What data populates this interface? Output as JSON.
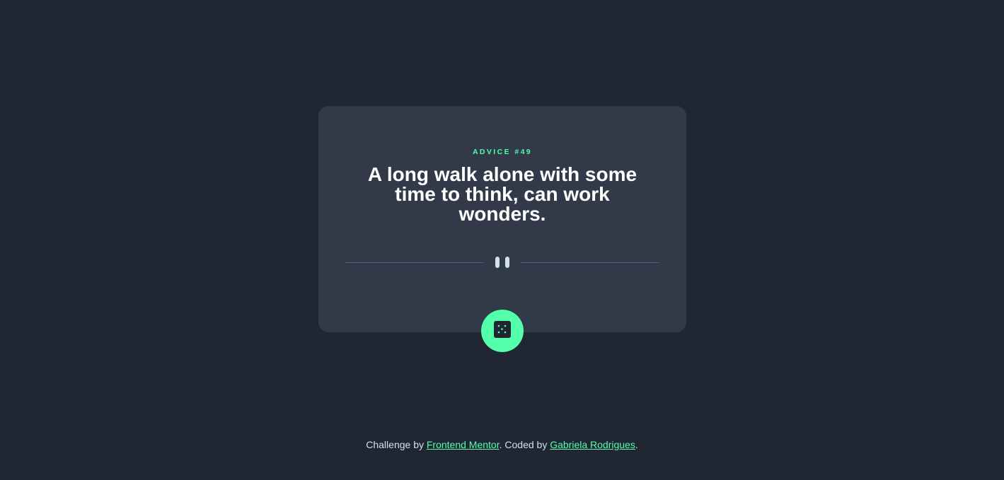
{
  "card": {
    "label": "ADVICE #49",
    "advice": "A long walk alone with some time to think, can work wonders.",
    "divider_icon": "pause-quote-icon",
    "button_icon": "dice-icon"
  },
  "footer": {
    "prefix": "Challenge by ",
    "link1": "Frontend Mentor",
    "middle": ". Coded by ",
    "link2": "Gabriela Rodrigues",
    "suffix": "."
  },
  "colors": {
    "background": "#202632",
    "card": "#323A49",
    "accent": "#53FFAA",
    "text": "#FFFFFF",
    "muted": "#CEE3E9",
    "divider": "#4F5D74"
  }
}
